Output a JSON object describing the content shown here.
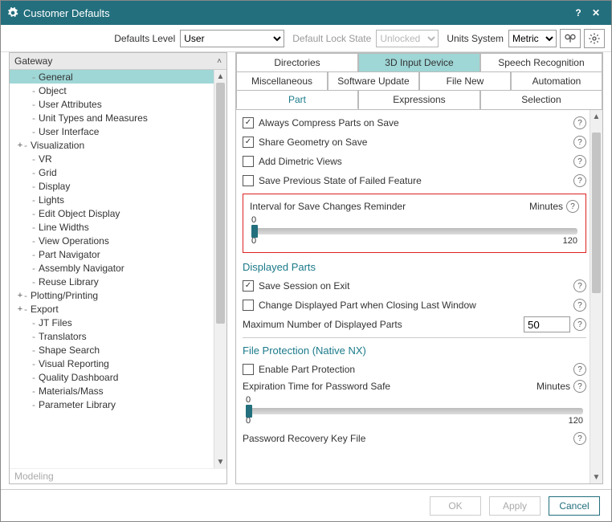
{
  "window": {
    "title": "Customer Defaults"
  },
  "toolbar": {
    "defaults_level_label": "Defaults Level",
    "defaults_level_value": "User",
    "lock_state_label": "Default Lock State",
    "lock_state_value": "Unlocked",
    "units_label": "Units System",
    "units_value": "Metric"
  },
  "nav": {
    "header": "Gateway",
    "footer_hint": "Modeling",
    "items": [
      {
        "label": "General",
        "level": 1,
        "selected": true
      },
      {
        "label": "Object",
        "level": 1
      },
      {
        "label": "User Attributes",
        "level": 1
      },
      {
        "label": "Unit Types and Measures",
        "level": 1
      },
      {
        "label": "User Interface",
        "level": 1
      },
      {
        "label": "Visualization",
        "level": 0,
        "expander": "+"
      },
      {
        "label": "VR",
        "level": 1
      },
      {
        "label": "Grid",
        "level": 1
      },
      {
        "label": "Display",
        "level": 1
      },
      {
        "label": "Lights",
        "level": 1
      },
      {
        "label": "Edit Object Display",
        "level": 1
      },
      {
        "label": "Line Widths",
        "level": 1
      },
      {
        "label": "View Operations",
        "level": 1
      },
      {
        "label": "Part Navigator",
        "level": 1
      },
      {
        "label": "Assembly Navigator",
        "level": 1
      },
      {
        "label": "Reuse Library",
        "level": 1
      },
      {
        "label": "Plotting/Printing",
        "level": 0,
        "expander": "+"
      },
      {
        "label": "Export",
        "level": 0,
        "expander": "+"
      },
      {
        "label": "JT Files",
        "level": 1
      },
      {
        "label": "Translators",
        "level": 1
      },
      {
        "label": "Shape Search",
        "level": 1
      },
      {
        "label": "Visual Reporting",
        "level": 1
      },
      {
        "label": "Quality Dashboard",
        "level": 1
      },
      {
        "label": "Materials/Mass",
        "level": 1
      },
      {
        "label": "Parameter Library",
        "level": 1
      }
    ]
  },
  "tabs": {
    "row1": [
      "Directories",
      "3D Input Device",
      "Speech Recognition"
    ],
    "row1_active": "3D Input Device",
    "row2": [
      "Miscellaneous",
      "Software Update",
      "File New",
      "Automation"
    ],
    "row3": [
      "Part",
      "Expressions",
      "Selection"
    ],
    "row3_active": "Part"
  },
  "settings": {
    "always_compress": {
      "label": "Always Compress Parts on Save",
      "checked": true
    },
    "share_geometry": {
      "label": "Share Geometry on Save",
      "checked": true
    },
    "add_dimetric": {
      "label": "Add Dimetric Views",
      "checked": false
    },
    "save_prev_state": {
      "label": "Save Previous State of Failed Feature",
      "checked": false
    },
    "reminder": {
      "title": "Interval for Save Changes Reminder",
      "units": "Minutes",
      "value": 0,
      "min": 0,
      "max": 120
    },
    "displayed_parts_title": "Displayed Parts",
    "save_session": {
      "label": "Save Session on Exit",
      "checked": true
    },
    "change_displayed": {
      "label": "Change Displayed Part when Closing Last Window",
      "checked": false
    },
    "max_displayed": {
      "label": "Maximum Number of Displayed Parts",
      "value": "50"
    },
    "file_protection_title": "File Protection (Native NX)",
    "enable_protection": {
      "label": "Enable Part Protection",
      "checked": false
    },
    "expiration": {
      "title": "Expiration Time for Password Safe",
      "units": "Minutes",
      "value": 0,
      "min": 0,
      "max": 120
    },
    "pwd_recovery_label": "Password Recovery Key File"
  },
  "footer": {
    "ok": "OK",
    "apply": "Apply",
    "cancel": "Cancel"
  }
}
